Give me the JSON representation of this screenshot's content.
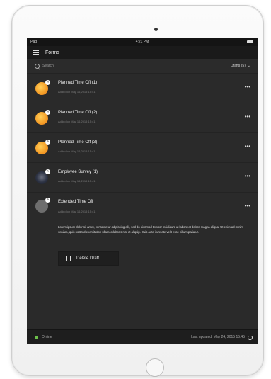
{
  "status_bar": {
    "carrier": "iPad",
    "time": "4:21 PM"
  },
  "app_bar": {
    "title": "Forms"
  },
  "search": {
    "placeholder": "Search",
    "filter_label": "Drafts (5)"
  },
  "items": [
    {
      "title": "Planned Time Off (1)",
      "subtitle": "Added on May 16,2015 15:41",
      "avatar": "orange"
    },
    {
      "title": "Planned Time Off (2)",
      "subtitle": "Added on May 16,2015 15:41",
      "avatar": "orange"
    },
    {
      "title": "Planned Time Off (3)",
      "subtitle": "Added on May 16,2015 15:41",
      "avatar": "orange"
    },
    {
      "title": "Employee Survey (1)",
      "subtitle": "Added on May 16,2015 15:41",
      "avatar": "dark"
    },
    {
      "title": "Extended Time Off",
      "subtitle": "Added on May 16,2015 15:41",
      "avatar": "gray",
      "description": "Lorem ipsum dolor sit amet, consectetur adipiscing elit, sed do eiusmod tempor incididunt ut labore et dolore magna aliqua. Ut enim ad minim veniam, quis nostrud exercitation ullamco laboris nisi ut aliquip. Duis aute irure ate velit esse cillum pariatur.",
      "delete_label": "Delete Draft"
    }
  ],
  "more_label": "•••",
  "footer": {
    "status": "Online",
    "last_updated": "Last updated: May 24, 2015 15:45"
  },
  "colors": {
    "online": "#6cc04a",
    "screen_bg": "#2a2a2a",
    "accent_orange": "#f5a02a"
  }
}
